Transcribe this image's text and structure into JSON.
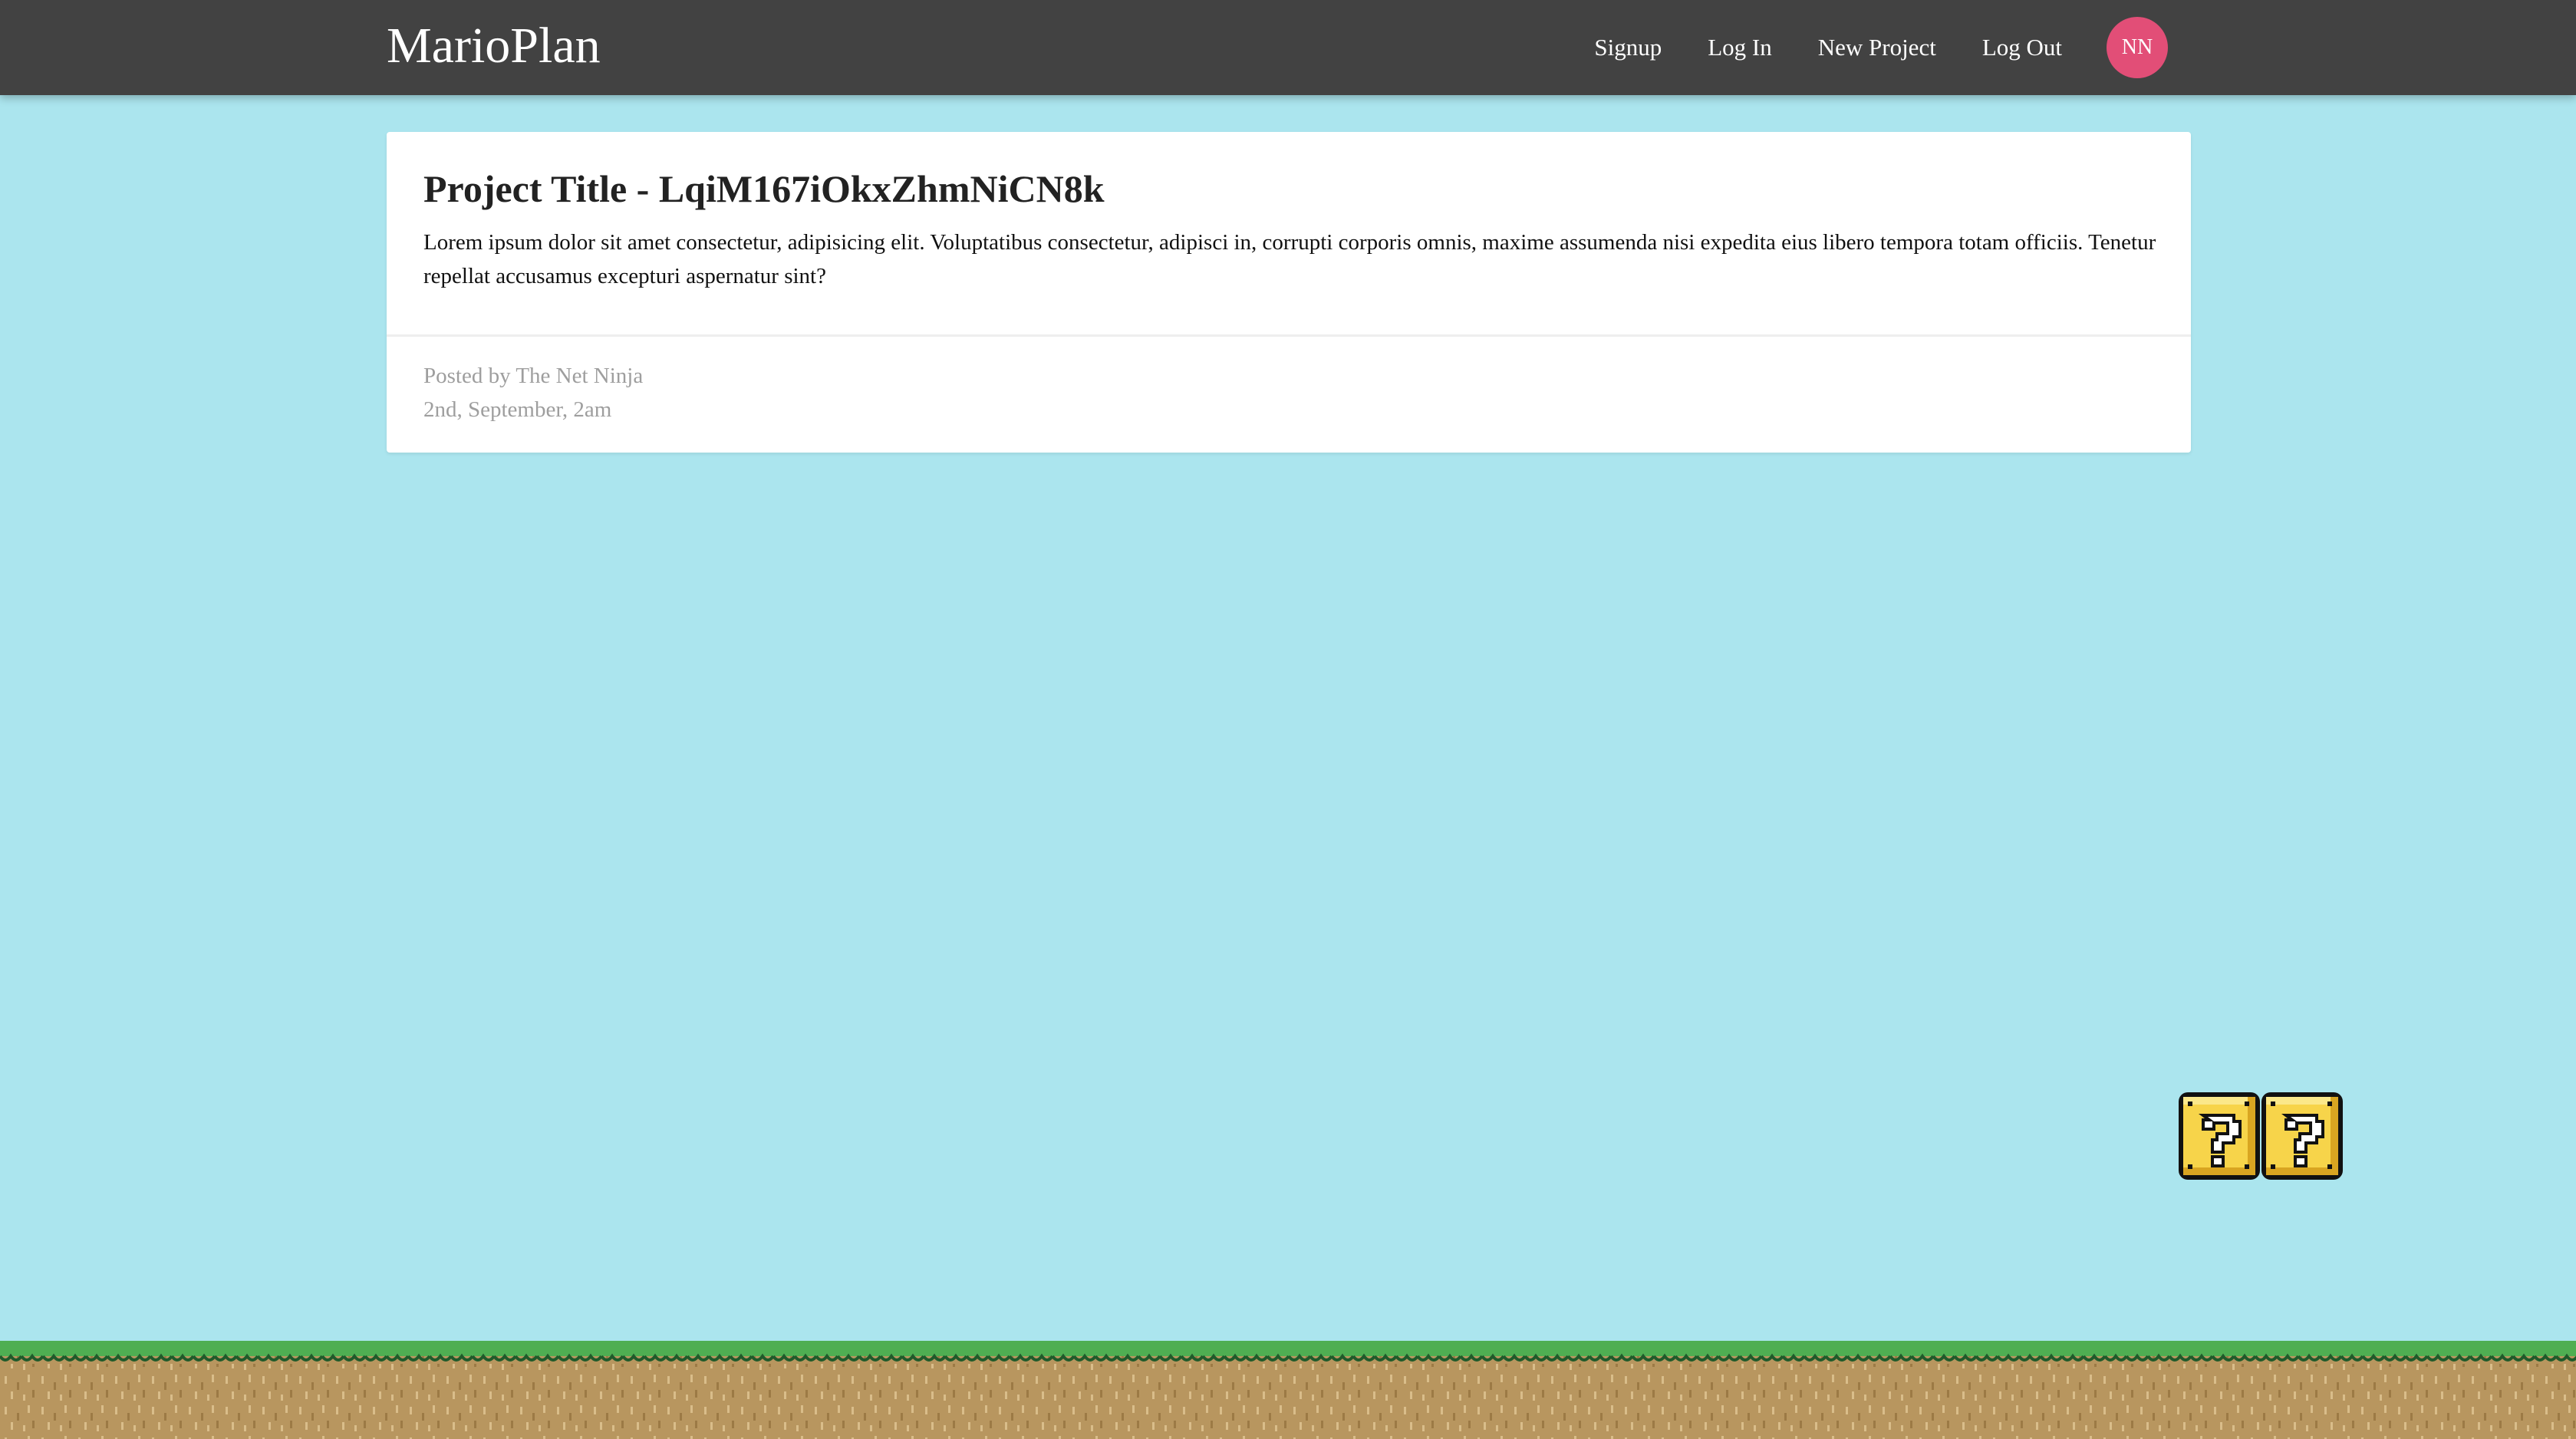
{
  "app": {
    "brand": "MarioPlan"
  },
  "nav": {
    "links": [
      "Signup",
      "Log In",
      "New Project",
      "Log Out"
    ],
    "avatar_initials": "NN"
  },
  "project": {
    "title": "Project Title - LqiM167iOkxZhmNiCN8k",
    "content": "Lorem ipsum dolor sit amet consectetur, adipisicing elit. Voluptatibus consectetur, adipisci in, corrupti corporis omnis, maxime assumenda nisi expedita eius libero tempora totam officiis. Tenetur repellat accusamus excepturi aspernatur sint?",
    "posted_by": "Posted by The Net Ninja",
    "date": "2nd, September, 2am"
  },
  "scene": {
    "decorations": [
      "question-block-icon",
      "question-block-icon",
      "grass-ground"
    ]
  },
  "colors": {
    "navbar": "#424242",
    "sky": "#abe5ee",
    "avatar": "#e24e77",
    "grass": "#4fae52",
    "dirt": "#b8965f",
    "block": "#f7d44a"
  }
}
